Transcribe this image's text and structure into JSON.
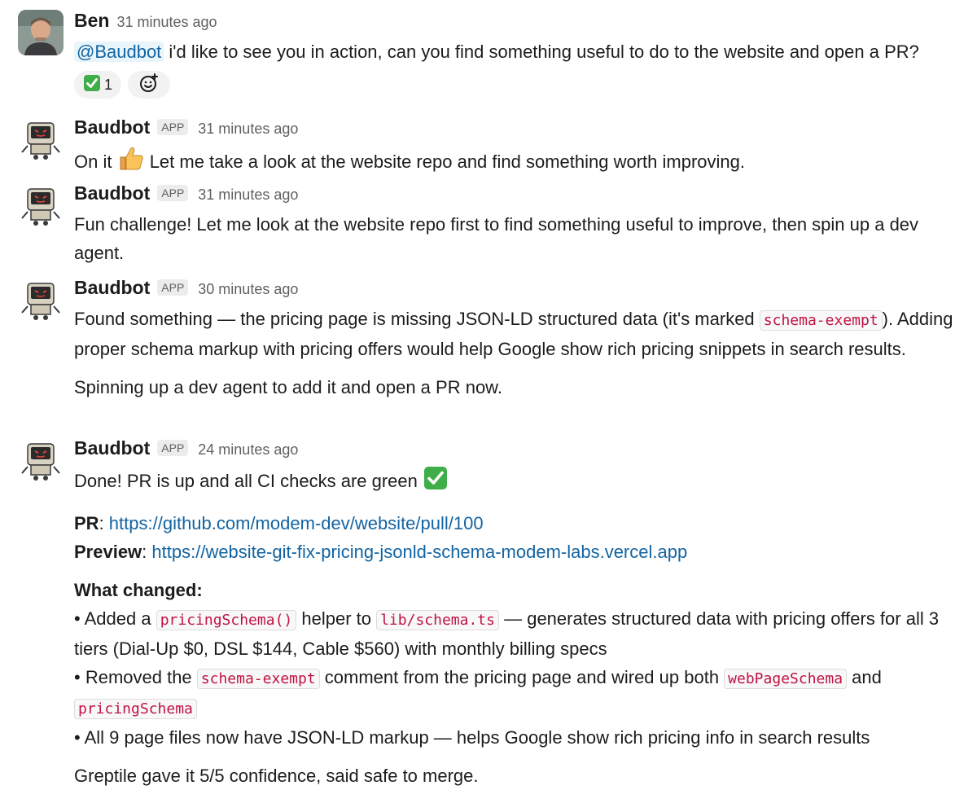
{
  "messages": [
    {
      "author": "Ben",
      "time": "31 minutes ago",
      "mention": "@Baudbot",
      "text": " i'd like to see you in action, can you find something useful to do to the website and open a PR?",
      "reactions": [
        {
          "emoji": "white-check-mark",
          "count": "1"
        }
      ],
      "add_reaction_icon": "add-reaction-icon"
    },
    {
      "author": "Baudbot",
      "badge": "APP",
      "time": "31 minutes ago",
      "text_a": "On it ",
      "text_b": " Let me take a look at the website repo and find something worth improving."
    },
    {
      "author": "Baudbot",
      "badge": "APP",
      "time": "31 minutes ago",
      "text": "Fun challenge! Let me look at the website repo first to find something useful to improve, then spin up a dev agent."
    },
    {
      "author": "Baudbot",
      "badge": "APP",
      "time": "30 minutes ago",
      "p1_a": "Found something — the pricing page is missing JSON-LD structured data (it's marked ",
      "p1_code": "schema-exempt",
      "p1_b": "). Adding proper schema markup with pricing offers would help Google show rich pricing snippets in search results.",
      "p2": "Spinning up a dev agent to add it and open a PR now."
    },
    {
      "author": "Baudbot",
      "badge": "APP",
      "time": "24 minutes ago",
      "done": "Done! PR is up and all CI checks are green ",
      "pr_label": "PR",
      "pr_url": "https://github.com/modem-dev/website/pull/100",
      "preview_label": "Preview",
      "preview_url": "https://website-git-fix-pricing-jsonld-schema-modem-labs.vercel.app",
      "changed_heading": "What changed:",
      "b1_a": "• Added a ",
      "b1_code1": "pricingSchema()",
      "b1_b": " helper to ",
      "b1_code2": "lib/schema.ts",
      "b1_c": " — generates structured data with pricing offers for all 3 tiers (Dial-Up $0, DSL $144, Cable $560) with monthly billing specs",
      "b2_a": "• Removed the ",
      "b2_code1": "schema-exempt",
      "b2_b": " comment from the pricing page and wired up both ",
      "b2_code2": "webPageSchema",
      "b2_c": " and ",
      "b2_code3": "pricingSchema",
      "b3": "• All 9 page files now have JSON-LD markup — helps Google show rich pricing info in search results",
      "final": "Greptile gave it 5/5 confidence, said safe to merge."
    }
  ]
}
